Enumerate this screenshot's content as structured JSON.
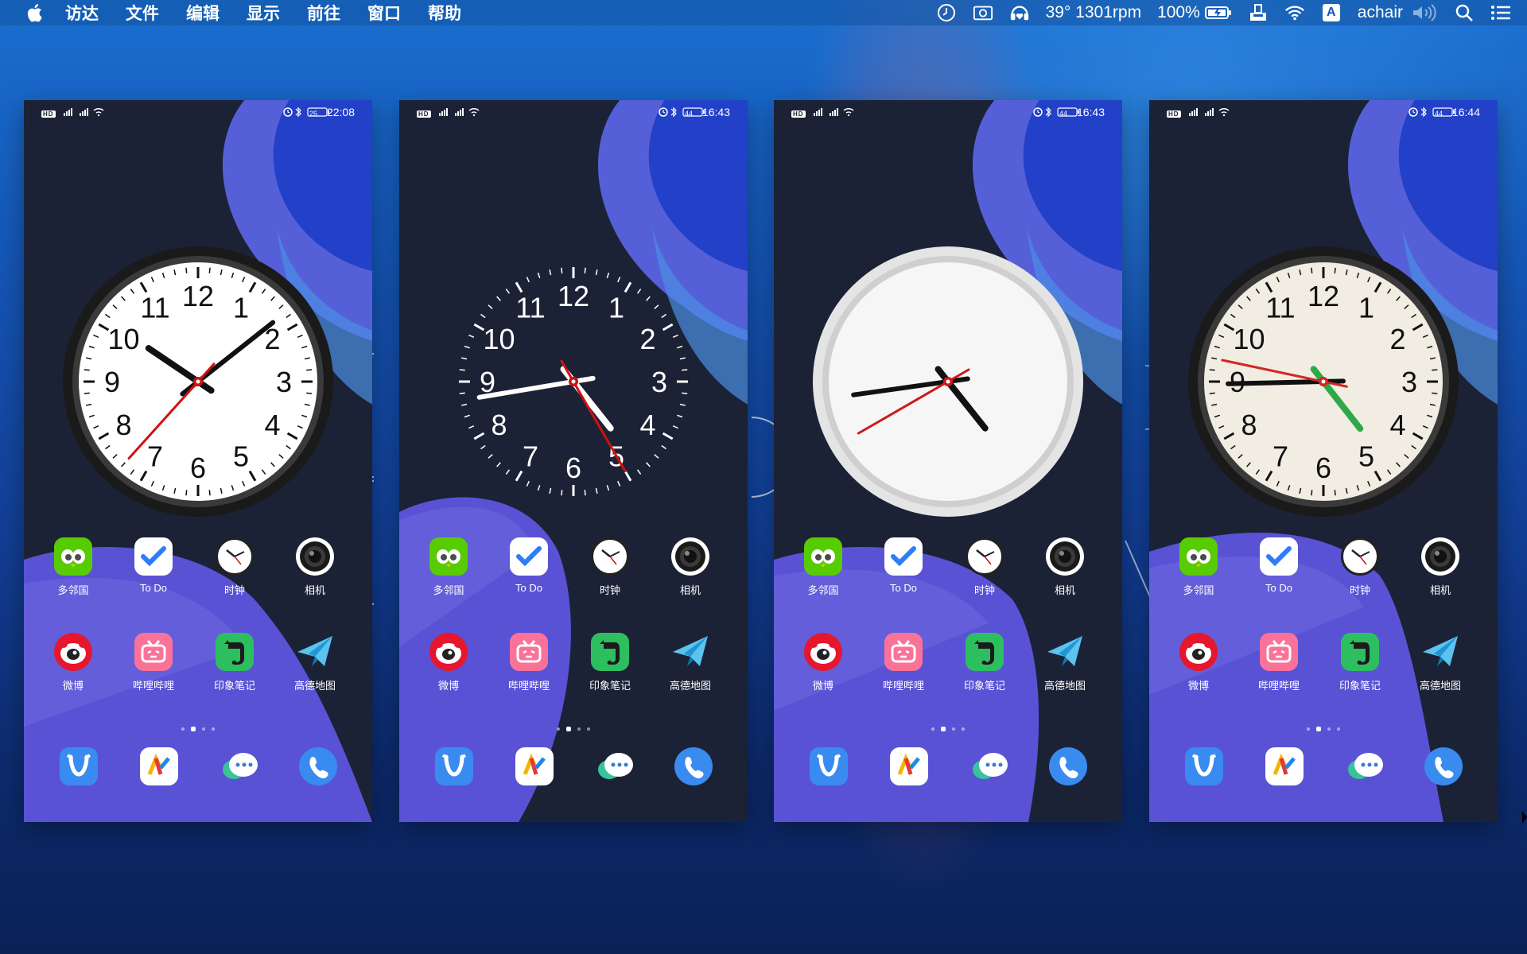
{
  "menubar": {
    "items": [
      "访达",
      "文件",
      "编辑",
      "显示",
      "前往",
      "窗口",
      "帮助"
    ],
    "status": {
      "temp_rpm": "39° 1301rpm",
      "battery": "100%",
      "input_method": "A",
      "user": "achair"
    }
  },
  "phones": [
    {
      "status_time": "22:08",
      "battery_level": "25",
      "clock_style": "black-rim",
      "clock_time": "22:08"
    },
    {
      "status_time": "16:43",
      "battery_level": "44",
      "clock_style": "minimal-dark",
      "clock_time": "16:43"
    },
    {
      "status_time": "16:43",
      "battery_level": "44",
      "clock_style": "white-rim-no-numbers",
      "clock_time": "16:43"
    },
    {
      "status_time": "16:44",
      "battery_level": "44",
      "clock_style": "cream-colored-hands",
      "clock_time": "16:44"
    }
  ],
  "apps": {
    "row1": [
      "多邻国",
      "To Do",
      "时钟",
      "相机"
    ],
    "row2": [
      "微博",
      "哔哩哔哩",
      "印象笔记",
      "高德地图"
    ]
  },
  "clock_numbers": [
    "12",
    "1",
    "2",
    "3",
    "4",
    "5",
    "6",
    "7",
    "8",
    "9",
    "10",
    "11"
  ],
  "status_left": "HD",
  "colors": {
    "accent": "#5a52d5",
    "phone_bg": "#1c2235",
    "duolingo": "#58cc02",
    "weibo": "#e6162d",
    "bilibili": "#fb7299",
    "evernote": "#2dbe60",
    "amap": "#1aa3ff"
  }
}
